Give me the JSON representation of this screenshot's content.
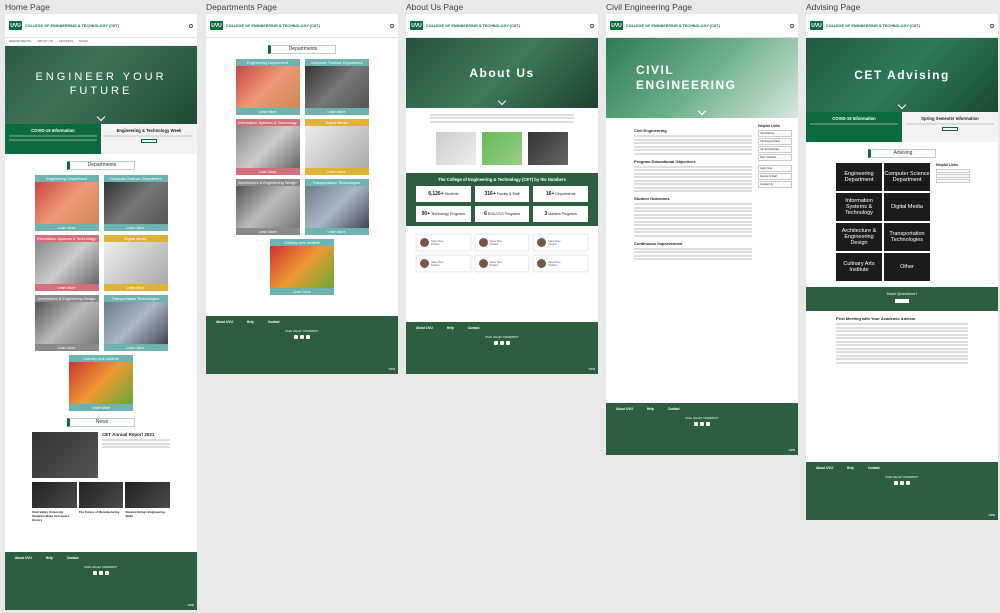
{
  "columns": [
    {
      "title": "Home Page"
    },
    {
      "title": "Departments Page"
    },
    {
      "title": "About Us Page"
    },
    {
      "title": "Civil Engineering Page"
    },
    {
      "title": "Advising Page"
    }
  ],
  "site": {
    "logo": "UVU",
    "org": "COLLEGE OF ENGINEERING & TECHNOLOGY (CET)",
    "nav": [
      "DEPARTMENTS",
      "ABOUT US",
      "ADVISING",
      "NEWS"
    ]
  },
  "home": {
    "hero": "ENGINEER YOUR FUTURE",
    "banner_left_title": "COVID-19 Information",
    "banner_right_title": "Engineering & Technology Week",
    "departments_head": "Departments",
    "news_head": "News",
    "news_main_title": "CET Annual Report 2021",
    "news_items": [
      "Utah Valley University Students Make Aerospace History",
      "The Future of Manufacturing",
      "Student Brings Engineering Skills"
    ]
  },
  "departments": {
    "head": "Departments",
    "cards": [
      {
        "label": "Engineering Department",
        "color": "#6fb3b1"
      },
      {
        "label": "Computer Science Department",
        "color": "#6fb3b1"
      },
      {
        "label": "Information Systems & Technology",
        "color": "#d36f78"
      },
      {
        "label": "Digital Media",
        "color": "#e0b23a"
      },
      {
        "label": "Architecture & Engineering Design",
        "color": "#8a8a8a"
      },
      {
        "label": "Transportation Technologies",
        "color": "#6fb3b1"
      },
      {
        "label": "Culinary Arts Institute",
        "color": "#6fb3b1"
      }
    ],
    "learn_more": "Learn More"
  },
  "about": {
    "hero": "About Us",
    "numbers_title": "The College of Engineering & Technology (CET) by the Numbers",
    "numbers": [
      {
        "n": "6,126+",
        "t": "Students"
      },
      {
        "n": "316+",
        "t": "Faculty & Staff"
      },
      {
        "n": "16+",
        "t": "Departments"
      },
      {
        "n": "90+",
        "t": "Technology Programs"
      },
      {
        "n": "6",
        "t": "ENG/VCS Programs"
      },
      {
        "n": "3",
        "t": "Masters Programs"
      }
    ],
    "person_name": "Name Here",
    "person_role": "Position"
  },
  "civil": {
    "hero": "CIVIL ENGINEERING",
    "headings": [
      "Civil Engineering",
      "Program Educational Objectives",
      "Student Outcomes",
      "Continuous Improvement"
    ],
    "helpful_links": "Helpful Links",
    "links": [
      "CE Advising",
      "CE Degree Maps",
      "CE Scholarships",
      "Dept. Website",
      "Apply Now",
      "Faculty & Staff",
      "Contact Us"
    ]
  },
  "advising": {
    "hero": "CET Advising",
    "banner_left_title": "COVID-19 Information",
    "banner_right_title": "Spring Semester Information",
    "head": "Advising",
    "cards": [
      "Engineering Department",
      "Computer Science Department",
      "Information Systems & Technology",
      "Digital Media",
      "Architecture & Engineering Design",
      "Transportation Technologies",
      "Culinary Arts Institute",
      "Other"
    ],
    "helpful_links": "Helpful Links",
    "questions": "Have Questions?",
    "first_meeting": "First Meeting with Your Academic Advisor"
  },
  "footer": {
    "brand": "UVU",
    "cols": [
      "About UVU",
      "Help",
      "Contact"
    ],
    "middle": "UTAH VALLEY UNIVERSITY"
  }
}
